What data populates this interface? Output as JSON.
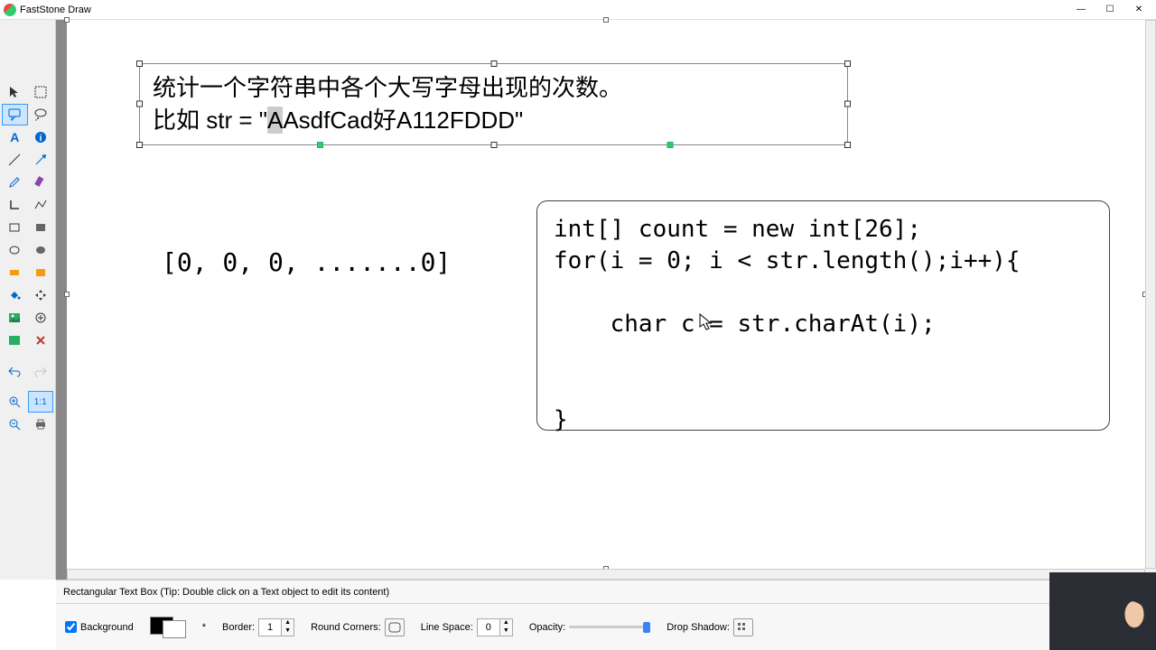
{
  "window": {
    "title": "FastStone Draw"
  },
  "canvas": {
    "problem_line1": "统计一个字符串中各个大写字母出现的次数。",
    "problem_line2_pre": "比如 str = \"",
    "problem_line2_hl": "A",
    "problem_line2_post": "AsdfCad好A112FDDD\"",
    "array_text": "[0, 0, 0, .......0]",
    "code": "int[] count = new int[26];\nfor(i = 0; i < str.length();i++){\n\n    char c = str.charAt(i);\n\n\n}"
  },
  "status": {
    "tip": "Rectangular Text Box (Tip: Double click on a Text object to edit its content)"
  },
  "options": {
    "background_label": "Background",
    "background_checked": true,
    "asterisk": "*",
    "border_label": "Border:",
    "border_value": "1",
    "round_label": "Round Corners:",
    "linespace_label": "Line Space:",
    "linespace_value": "0",
    "opacity_label": "Opacity:",
    "shadow_label": "Drop Shadow:"
  },
  "tools": {
    "ratio": "1:1"
  }
}
